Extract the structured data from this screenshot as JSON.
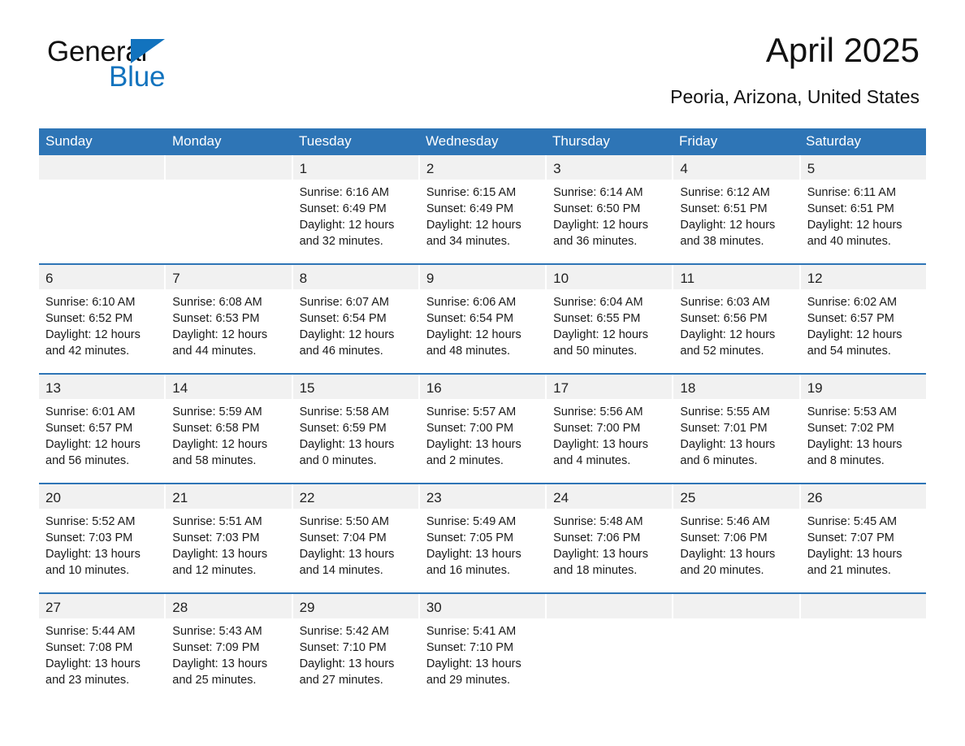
{
  "brand": {
    "line1": "General",
    "line2": "Blue",
    "triangle_color": "#1273be"
  },
  "header": {
    "title": "April 2025",
    "location": "Peoria, Arizona, United States",
    "accent_color": "#2e75b6"
  },
  "weekdays": [
    "Sunday",
    "Monday",
    "Tuesday",
    "Wednesday",
    "Thursday",
    "Friday",
    "Saturday"
  ],
  "labels": {
    "sunrise_prefix": "Sunrise: ",
    "sunset_prefix": "Sunset: ",
    "daylight_prefix": "Daylight: "
  },
  "weeks": [
    [
      {
        "empty": true
      },
      {
        "empty": true
      },
      {
        "day": "1",
        "sunrise": "Sunrise: 6:16 AM",
        "sunset": "Sunset: 6:49 PM",
        "daylight": "Daylight: 12 hours and 32 minutes."
      },
      {
        "day": "2",
        "sunrise": "Sunrise: 6:15 AM",
        "sunset": "Sunset: 6:49 PM",
        "daylight": "Daylight: 12 hours and 34 minutes."
      },
      {
        "day": "3",
        "sunrise": "Sunrise: 6:14 AM",
        "sunset": "Sunset: 6:50 PM",
        "daylight": "Daylight: 12 hours and 36 minutes."
      },
      {
        "day": "4",
        "sunrise": "Sunrise: 6:12 AM",
        "sunset": "Sunset: 6:51 PM",
        "daylight": "Daylight: 12 hours and 38 minutes."
      },
      {
        "day": "5",
        "sunrise": "Sunrise: 6:11 AM",
        "sunset": "Sunset: 6:51 PM",
        "daylight": "Daylight: 12 hours and 40 minutes."
      }
    ],
    [
      {
        "day": "6",
        "sunrise": "Sunrise: 6:10 AM",
        "sunset": "Sunset: 6:52 PM",
        "daylight": "Daylight: 12 hours and 42 minutes."
      },
      {
        "day": "7",
        "sunrise": "Sunrise: 6:08 AM",
        "sunset": "Sunset: 6:53 PM",
        "daylight": "Daylight: 12 hours and 44 minutes."
      },
      {
        "day": "8",
        "sunrise": "Sunrise: 6:07 AM",
        "sunset": "Sunset: 6:54 PM",
        "daylight": "Daylight: 12 hours and 46 minutes."
      },
      {
        "day": "9",
        "sunrise": "Sunrise: 6:06 AM",
        "sunset": "Sunset: 6:54 PM",
        "daylight": "Daylight: 12 hours and 48 minutes."
      },
      {
        "day": "10",
        "sunrise": "Sunrise: 6:04 AM",
        "sunset": "Sunset: 6:55 PM",
        "daylight": "Daylight: 12 hours and 50 minutes."
      },
      {
        "day": "11",
        "sunrise": "Sunrise: 6:03 AM",
        "sunset": "Sunset: 6:56 PM",
        "daylight": "Daylight: 12 hours and 52 minutes."
      },
      {
        "day": "12",
        "sunrise": "Sunrise: 6:02 AM",
        "sunset": "Sunset: 6:57 PM",
        "daylight": "Daylight: 12 hours and 54 minutes."
      }
    ],
    [
      {
        "day": "13",
        "sunrise": "Sunrise: 6:01 AM",
        "sunset": "Sunset: 6:57 PM",
        "daylight": "Daylight: 12 hours and 56 minutes."
      },
      {
        "day": "14",
        "sunrise": "Sunrise: 5:59 AM",
        "sunset": "Sunset: 6:58 PM",
        "daylight": "Daylight: 12 hours and 58 minutes."
      },
      {
        "day": "15",
        "sunrise": "Sunrise: 5:58 AM",
        "sunset": "Sunset: 6:59 PM",
        "daylight": "Daylight: 13 hours and 0 minutes."
      },
      {
        "day": "16",
        "sunrise": "Sunrise: 5:57 AM",
        "sunset": "Sunset: 7:00 PM",
        "daylight": "Daylight: 13 hours and 2 minutes."
      },
      {
        "day": "17",
        "sunrise": "Sunrise: 5:56 AM",
        "sunset": "Sunset: 7:00 PM",
        "daylight": "Daylight: 13 hours and 4 minutes."
      },
      {
        "day": "18",
        "sunrise": "Sunrise: 5:55 AM",
        "sunset": "Sunset: 7:01 PM",
        "daylight": "Daylight: 13 hours and 6 minutes."
      },
      {
        "day": "19",
        "sunrise": "Sunrise: 5:53 AM",
        "sunset": "Sunset: 7:02 PM",
        "daylight": "Daylight: 13 hours and 8 minutes."
      }
    ],
    [
      {
        "day": "20",
        "sunrise": "Sunrise: 5:52 AM",
        "sunset": "Sunset: 7:03 PM",
        "daylight": "Daylight: 13 hours and 10 minutes."
      },
      {
        "day": "21",
        "sunrise": "Sunrise: 5:51 AM",
        "sunset": "Sunset: 7:03 PM",
        "daylight": "Daylight: 13 hours and 12 minutes."
      },
      {
        "day": "22",
        "sunrise": "Sunrise: 5:50 AM",
        "sunset": "Sunset: 7:04 PM",
        "daylight": "Daylight: 13 hours and 14 minutes."
      },
      {
        "day": "23",
        "sunrise": "Sunrise: 5:49 AM",
        "sunset": "Sunset: 7:05 PM",
        "daylight": "Daylight: 13 hours and 16 minutes."
      },
      {
        "day": "24",
        "sunrise": "Sunrise: 5:48 AM",
        "sunset": "Sunset: 7:06 PM",
        "daylight": "Daylight: 13 hours and 18 minutes."
      },
      {
        "day": "25",
        "sunrise": "Sunrise: 5:46 AM",
        "sunset": "Sunset: 7:06 PM",
        "daylight": "Daylight: 13 hours and 20 minutes."
      },
      {
        "day": "26",
        "sunrise": "Sunrise: 5:45 AM",
        "sunset": "Sunset: 7:07 PM",
        "daylight": "Daylight: 13 hours and 21 minutes."
      }
    ],
    [
      {
        "day": "27",
        "sunrise": "Sunrise: 5:44 AM",
        "sunset": "Sunset: 7:08 PM",
        "daylight": "Daylight: 13 hours and 23 minutes."
      },
      {
        "day": "28",
        "sunrise": "Sunrise: 5:43 AM",
        "sunset": "Sunset: 7:09 PM",
        "daylight": "Daylight: 13 hours and 25 minutes."
      },
      {
        "day": "29",
        "sunrise": "Sunrise: 5:42 AM",
        "sunset": "Sunset: 7:10 PM",
        "daylight": "Daylight: 13 hours and 27 minutes."
      },
      {
        "day": "30",
        "sunrise": "Sunrise: 5:41 AM",
        "sunset": "Sunset: 7:10 PM",
        "daylight": "Daylight: 13 hours and 29 minutes."
      },
      {
        "empty": true
      },
      {
        "empty": true
      },
      {
        "empty": true
      }
    ]
  ]
}
